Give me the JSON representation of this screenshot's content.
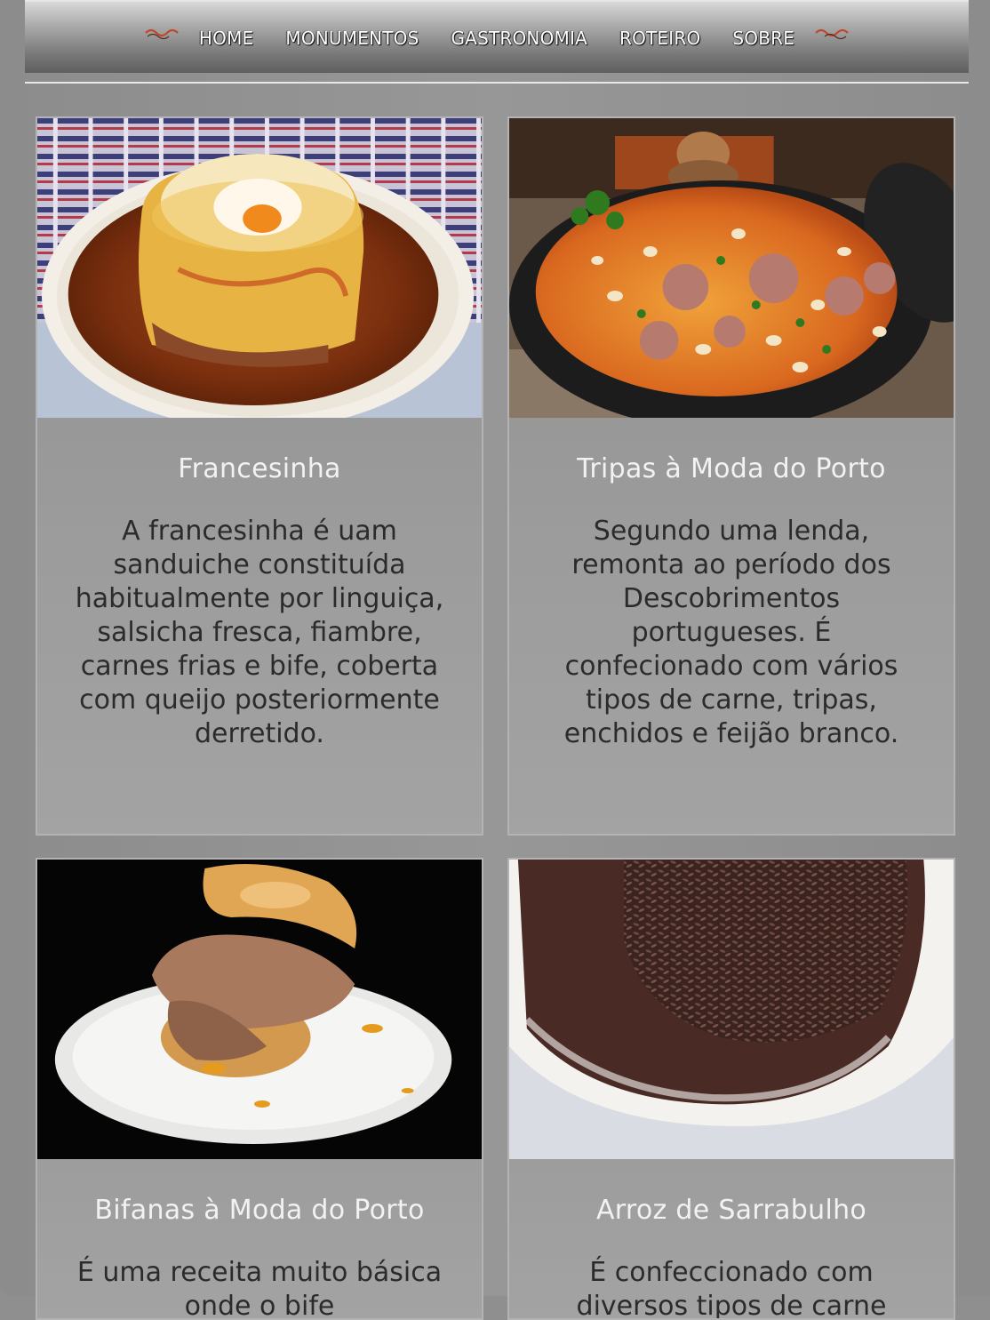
{
  "nav": {
    "items": [
      "HOME",
      "MONUMENTOS",
      "GASTRONOMIA",
      "ROTEIRO",
      "SOBRE"
    ],
    "accent_color": "#c0462b"
  },
  "cards": [
    {
      "title": "Francesinha",
      "text": "A francesinha é uam sanduiche constituída habitualmente por linguiça, salsicha fresca, fiambre, carnes frias e bife, coberta com queijo posteriormente derretido.",
      "image": "francesinha-photo"
    },
    {
      "title": "Tripas à Moda do Porto",
      "text": "Segundo uma lenda, remonta ao período dos Descobrimentos portugueses. É confecionado com vários tipos de carne, tripas, enchidos e feijão branco.",
      "image": "tripas-photo"
    },
    {
      "title": "Bifanas à Moda do Porto",
      "text": "É uma receita muito básica onde o bife",
      "image": "bifanas-photo"
    },
    {
      "title": "Arroz de Sarrabulho",
      "text": "É confeccionado com diversos tipos de carne",
      "image": "sarrabulho-photo"
    }
  ]
}
